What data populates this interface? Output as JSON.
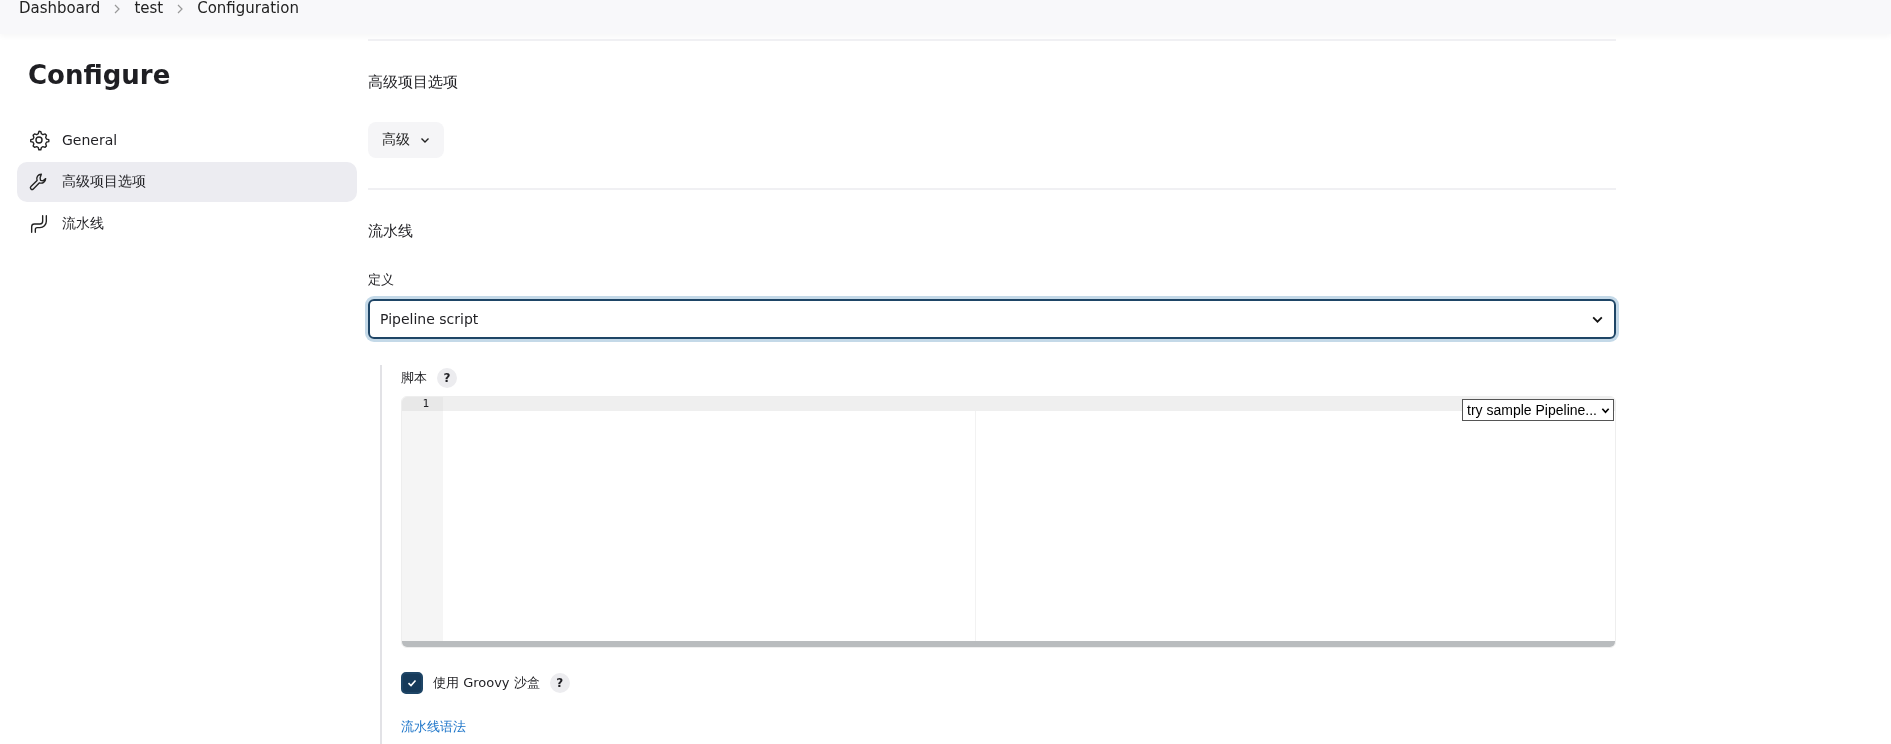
{
  "breadcrumbs": [
    {
      "label": "Dashboard"
    },
    {
      "label": "test"
    },
    {
      "label": "Configuration"
    }
  ],
  "sidebar": {
    "title": "Configure",
    "items": [
      {
        "label": "General",
        "kind": "gear",
        "selected": false
      },
      {
        "label": "高级项目选项",
        "kind": "wrench",
        "selected": true
      },
      {
        "label": "流水线",
        "kind": "pipe",
        "selected": false
      }
    ]
  },
  "advanced": {
    "heading": "高级项目选项",
    "button": "高级"
  },
  "pipeline": {
    "heading": "流水线",
    "definition_label": "定义",
    "definition_value": "Pipeline script",
    "script": {
      "label": "脚本",
      "help": "?",
      "line_numbers": [
        "1"
      ],
      "sample_select": "try sample Pipeline..."
    },
    "sandbox": {
      "label": "使用 Groovy 沙盒",
      "checked": true,
      "help": "?"
    },
    "syntax_link": "流水线语法"
  }
}
